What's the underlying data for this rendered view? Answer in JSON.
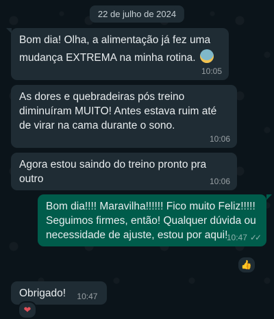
{
  "chat": {
    "date_chip": "22 de julho de 2024",
    "messages": [
      {
        "text_line1": "Bom dia! Olha, a alimentação já fez uma",
        "text_line2": "mudança EXTREMA na minha rotina.",
        "emoji": "anxious-face-icon",
        "time": "10:05",
        "direction": "in"
      },
      {
        "text": "As dores e quebradeiras pós treino diminuíram MUITO! Antes estava ruim até de virar na cama durante o sono.",
        "time": "10:06",
        "direction": "in"
      },
      {
        "text": "Agora estou saindo do treino pronto pra outro",
        "time": "10:06",
        "direction": "in"
      },
      {
        "text": "Bom dia!!!! Maravilha!!!!!! Fico muito Feliz!!!!! Seguimos firmes, então! Qualquer dúvida ou necessidade de ajuste, estou por aqui!",
        "time": "10:47",
        "direction": "out",
        "status": "read-checkmarks",
        "reaction": "thumbs-up-icon"
      },
      {
        "text": "Obrigado!",
        "time": "10:47",
        "direction": "in",
        "reaction": "heart-icon"
      }
    ]
  },
  "colors": {
    "background": "#0b141a",
    "incoming_bubble": "#1f2c34",
    "outgoing_bubble": "#005c4b",
    "text": "#e9edef"
  }
}
